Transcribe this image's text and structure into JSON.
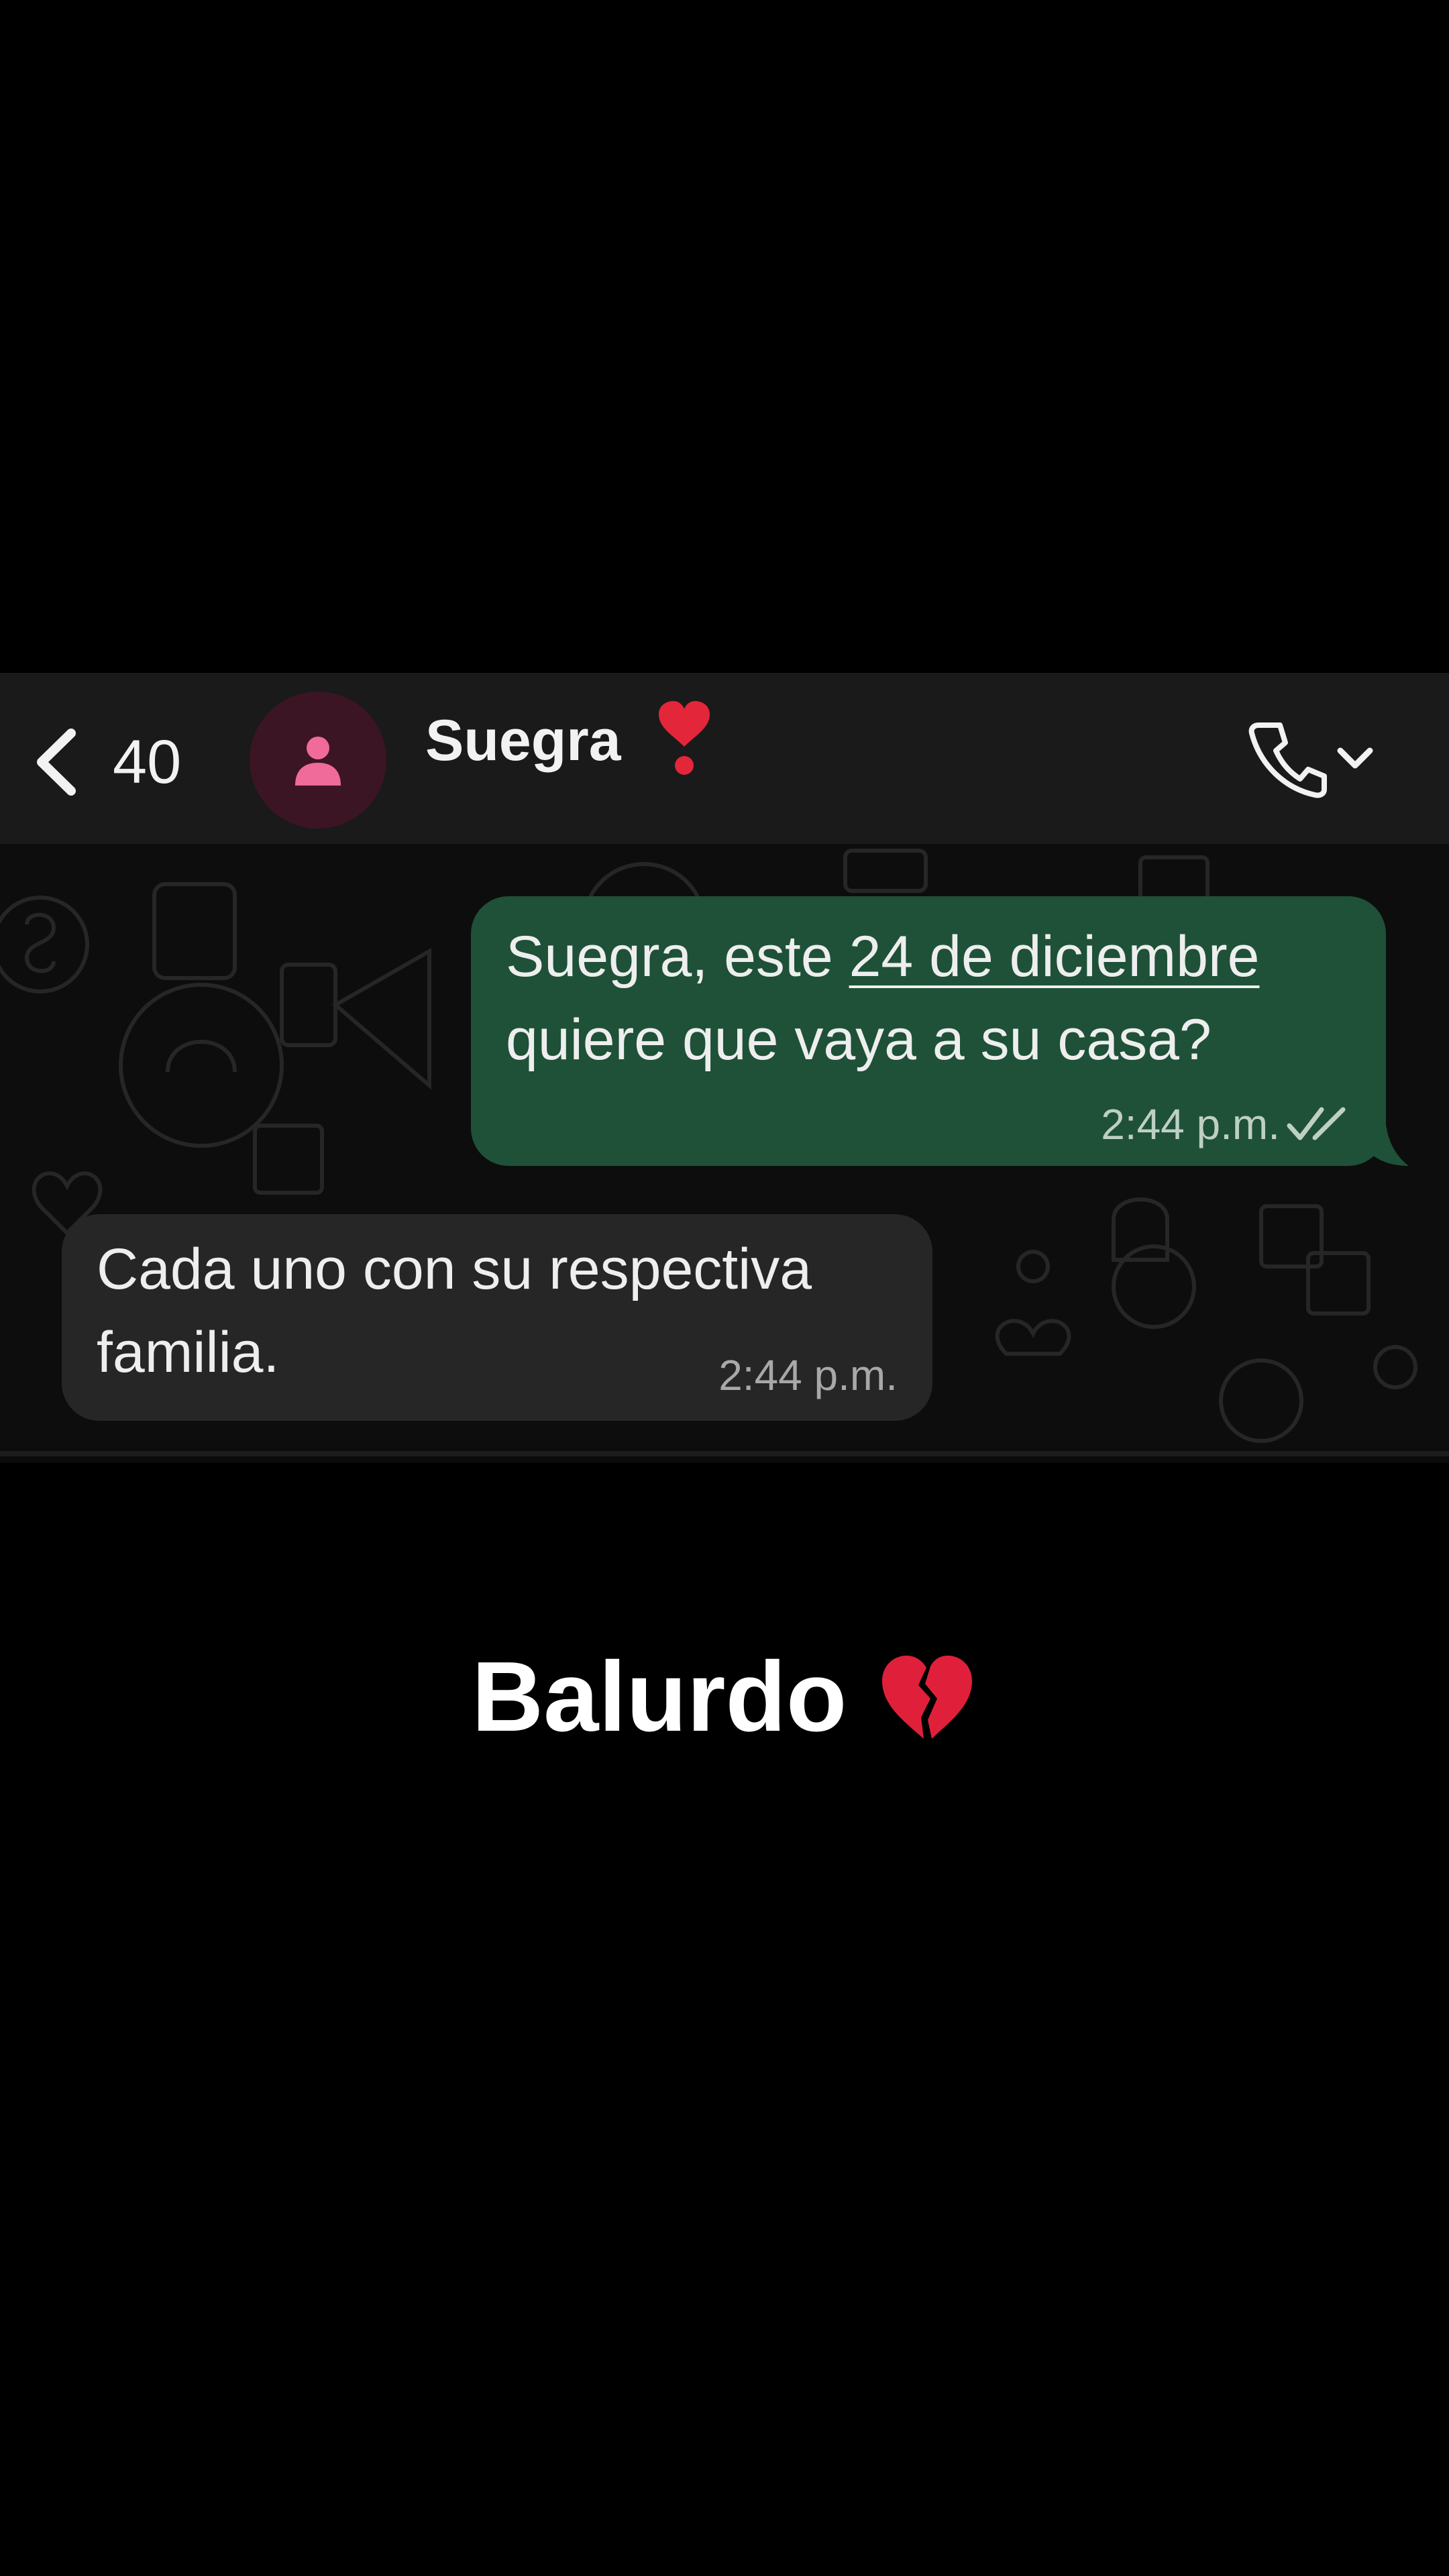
{
  "header": {
    "back_count": "40",
    "contact_name": "Suegra",
    "name_emoji": "heavy-heart-exclamation-icon",
    "avatar_icon": "person-icon",
    "call_icon": "phone-icon",
    "menu_icon": "chevron-down-icon"
  },
  "messages": [
    {
      "direction": "outgoing",
      "line1_prefix": "Suegra, este ",
      "line1_link": "24 de diciembre",
      "line2": "quiere que vaya a su casa?",
      "time": "2:44 p.m.",
      "status_icon": "double-check-icon"
    },
    {
      "direction": "incoming",
      "line1": "Cada uno con su respectiva",
      "line2": "familia.",
      "time": "2:44 p.m."
    }
  ],
  "caption": {
    "text": "Balurdo",
    "emoji": "broken-heart-icon"
  },
  "colors": {
    "outgoing_bubble": "#1e5138",
    "incoming_bubble": "#262626",
    "header_bg": "#1a1a1a",
    "avatar_bg": "#3c1524",
    "avatar_person": "#f06a9a",
    "heart": "#e3263a"
  }
}
